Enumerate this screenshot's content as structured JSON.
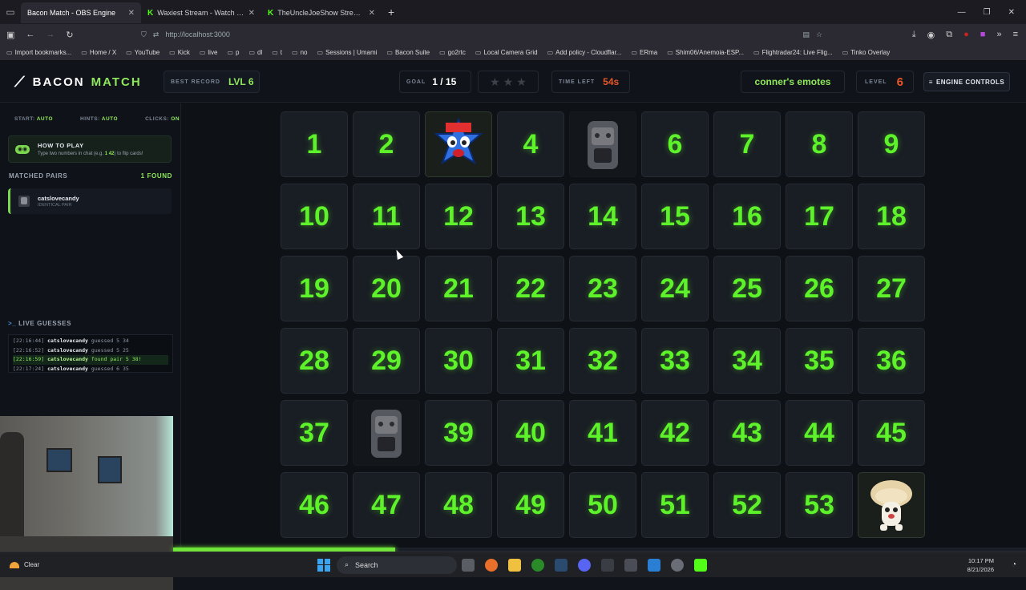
{
  "browser": {
    "tabs": [
      {
        "title": "Bacon Match - OBS Engine",
        "active": true
      },
      {
        "title": "Waxiest Stream - Watch Live on",
        "active": false
      },
      {
        "title": "TheUncleJoeShow Stream -",
        "active": false
      }
    ],
    "url": "http://localhost:3000",
    "bookmarks": [
      "Import bookmarks...",
      "Home / X",
      "YouTube",
      "Kick",
      "live",
      "p",
      "dl",
      "t",
      "no",
      "Sessions | Umami",
      "Bacon Suite",
      "go2rtc",
      "Local Camera Grid",
      "Add policy - Cloudflar...",
      "ERma",
      "Shim06/Anemoia-ESP...",
      "Flightradar24: Live Flig...",
      "Tinko Overlay"
    ]
  },
  "header": {
    "brand_first": "BACON",
    "brand_second": "MATCH",
    "best_label": "BEST RECORD",
    "best_value": "LVL 6",
    "goal_label": "GOAL",
    "goal_value": "1 / 15",
    "stars_count": 3,
    "time_label": "TIME LEFT",
    "time_value": "54s",
    "emote_set": "conner's emotes",
    "level_label": "LEVEL",
    "level_value": "6",
    "engine_button": "ENGINE CONTROLS"
  },
  "sidebar": {
    "start_label": "START:",
    "start_value": "AUTO",
    "hints_label": "HINTS:",
    "hints_value": "AUTO",
    "clicks_label": "CLICKS:",
    "clicks_value": "ON",
    "howto_title": "HOW TO PLAY",
    "howto_text_pre": "Type two numbers in chat (e.g. ",
    "howto_example": "1 42",
    "howto_text_post": ") to flip cards!",
    "matched_title": "MATCHED PAIRS",
    "matched_count": "1 FOUND",
    "pairs": [
      {
        "name": "catslovecandy",
        "sub": "IDENTICAL PAIR"
      }
    ],
    "live_title": "LIVE GUESSES",
    "log": [
      {
        "time": "[22:16:44]",
        "user": "catslovecandy",
        "text": "guessed 5 34",
        "highlight": false
      },
      {
        "time": "[22:16:52]",
        "user": "catslovecandy",
        "text": "guessed 5 25",
        "highlight": false
      },
      {
        "time": "[22:16:59]",
        "user": "catslovecandy",
        "text": "found pair 5 38!",
        "highlight": true
      },
      {
        "time": "[22:17:24]",
        "user": "catslovecandy",
        "text": "guessed 6 35",
        "highlight": false
      }
    ]
  },
  "board": {
    "cards": [
      "1",
      "2",
      "emote-blue-face",
      "4",
      "emote-cat-dim",
      "6",
      "7",
      "8",
      "9",
      "10",
      "11",
      "12",
      "13",
      "14",
      "15",
      "16",
      "17",
      "18",
      "19",
      "20",
      "21",
      "22",
      "23",
      "24",
      "25",
      "26",
      "27",
      "28",
      "29",
      "30",
      "31",
      "32",
      "33",
      "34",
      "35",
      "36",
      "37",
      "emote-cat-dim",
      "39",
      "40",
      "41",
      "42",
      "43",
      "44",
      "45",
      "46",
      "47",
      "48",
      "49",
      "50",
      "51",
      "52",
      "53",
      "emote-mushroom"
    ]
  },
  "progress": 0.26,
  "taskbar": {
    "weather": "Clear",
    "search": "Search",
    "time": "10:17 PM",
    "date": "8/21/2026"
  },
  "colors": {
    "accent": "#5ef22a",
    "warn": "#e8562a",
    "bg": "#0e1116"
  }
}
